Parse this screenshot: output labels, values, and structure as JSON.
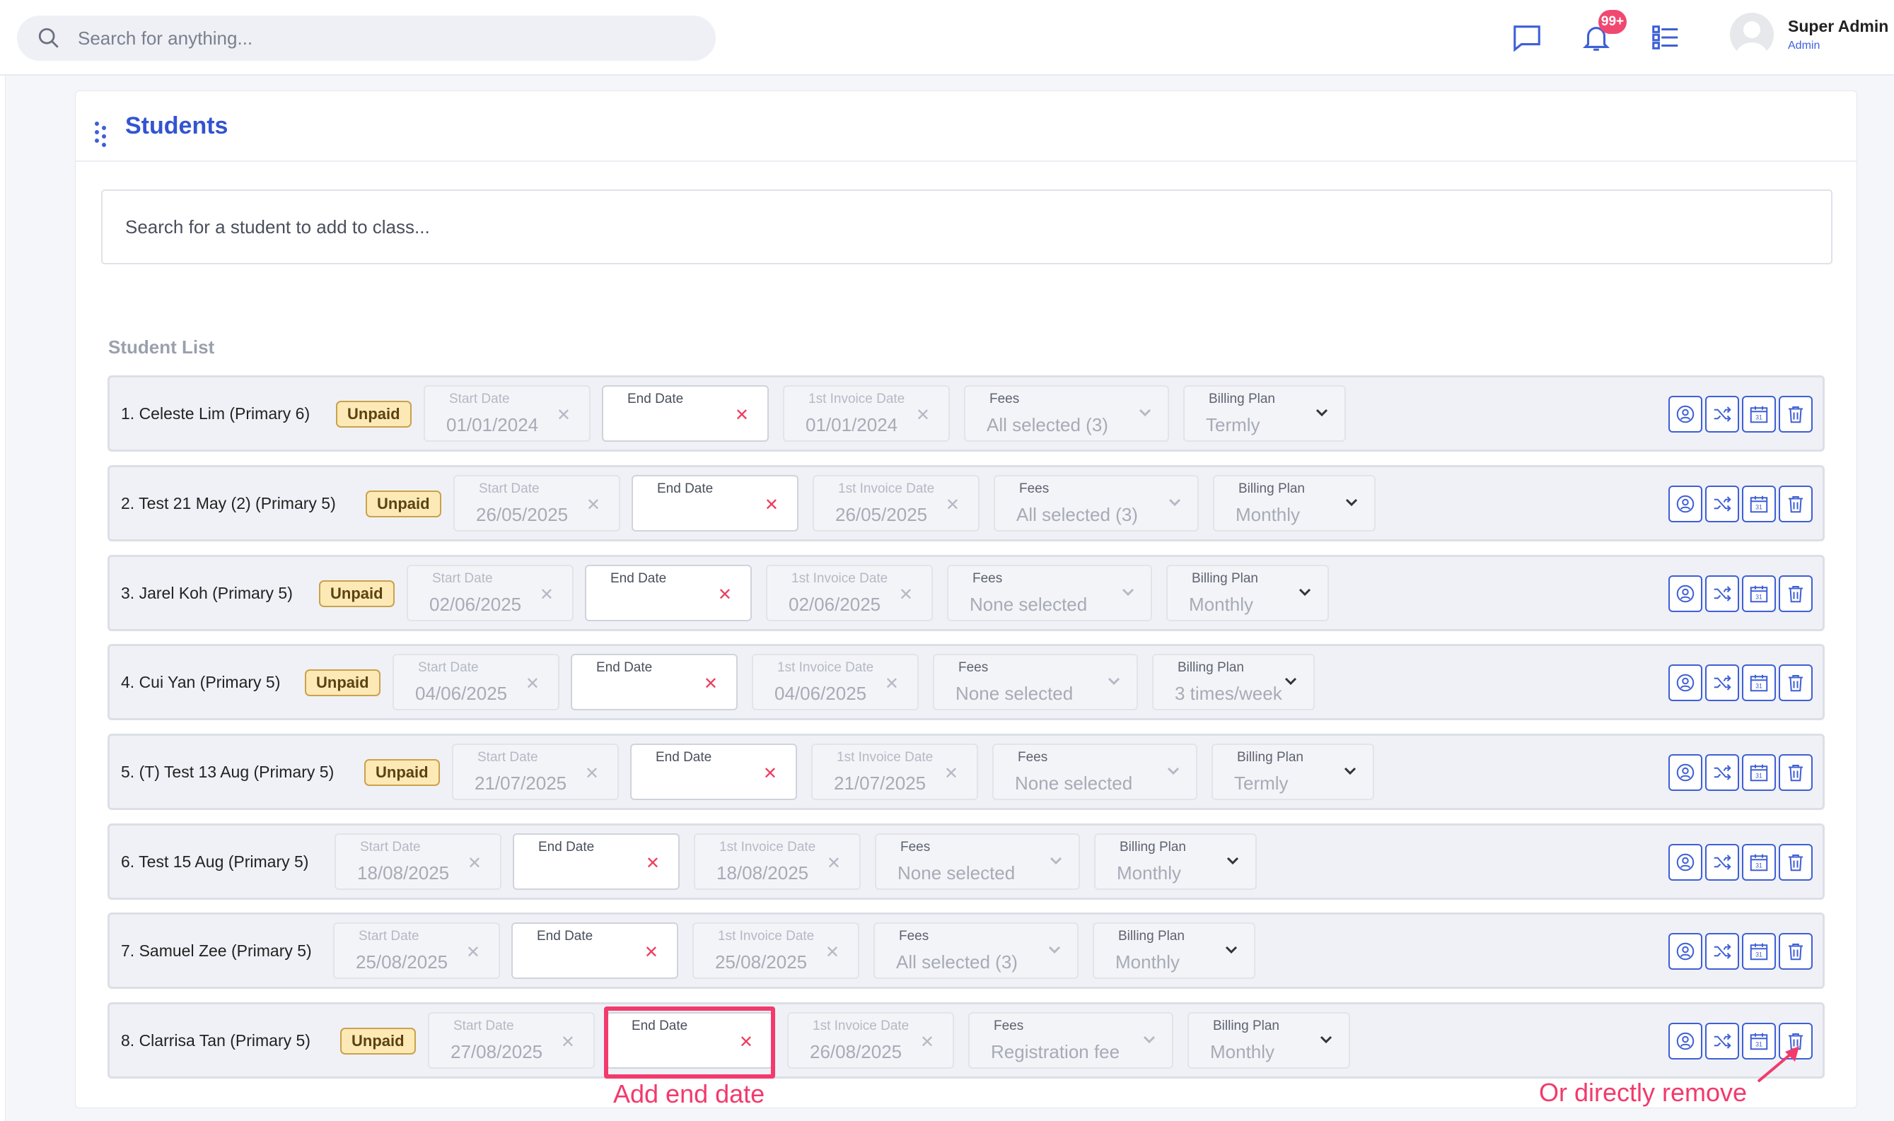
{
  "topbar": {
    "search_placeholder": "Search for anything...",
    "notification_badge": "99+",
    "user_name": "Super Admin",
    "user_role": "Admin"
  },
  "card": {
    "title": "Students",
    "student_search_placeholder": "Search for a student to add to class...",
    "list_label": "Student List"
  },
  "field_labels": {
    "start": "Start Date",
    "end": "End Date",
    "invoice": "1st Invoice Date",
    "fees": "Fees",
    "billing": "Billing Plan"
  },
  "unpaid_label": "Unpaid",
  "students": [
    {
      "name": "1. Celeste Lim (Primary 6)",
      "unpaid": true,
      "start": "01/01/2024",
      "invoice": "01/01/2024",
      "fees": "All selected (3)",
      "billing": "Termly"
    },
    {
      "name": "2. Test 21 May (2) (Primary 5)",
      "unpaid": true,
      "start": "26/05/2025",
      "invoice": "26/05/2025",
      "fees": "All selected (3)",
      "billing": "Monthly"
    },
    {
      "name": "3. Jarel Koh (Primary 5)",
      "unpaid": true,
      "start": "02/06/2025",
      "invoice": "02/06/2025",
      "fees": "None selected",
      "billing": "Monthly"
    },
    {
      "name": "4. Cui Yan (Primary 5)",
      "unpaid": true,
      "start": "04/06/2025",
      "invoice": "04/06/2025",
      "fees": "None selected",
      "billing": "3 times/week"
    },
    {
      "name": "5. (T) Test 13 Aug (Primary 5)",
      "unpaid": true,
      "start": "21/07/2025",
      "invoice": "21/07/2025",
      "fees": "None selected",
      "billing": "Termly"
    },
    {
      "name": "6. Test 15 Aug (Primary 5)",
      "unpaid": false,
      "start": "18/08/2025",
      "invoice": "18/08/2025",
      "fees": "None selected",
      "billing": "Monthly"
    },
    {
      "name": "7. Samuel Zee (Primary 5)",
      "unpaid": false,
      "start": "25/08/2025",
      "invoice": "25/08/2025",
      "fees": "All selected (3)",
      "billing": "Monthly"
    },
    {
      "name": "8. Clarrisa Tan (Primary 5)",
      "unpaid": true,
      "start": "27/08/2025",
      "invoice": "26/08/2025",
      "fees": "Registration fee",
      "billing": "Monthly"
    }
  ],
  "annotations": {
    "add_end_date": "Add end date",
    "directly_remove": "Or directly remove"
  },
  "colors": {
    "accent": "#3354d1",
    "annotation": "#f23a6c",
    "unpaid_bg": "#fde9b6"
  }
}
